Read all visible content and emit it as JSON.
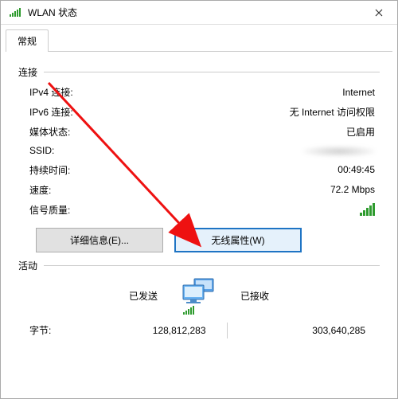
{
  "window": {
    "title": "WLAN 状态"
  },
  "tabs": {
    "general": "常规"
  },
  "conn": {
    "section": "连接",
    "ipv4_label": "IPv4 连接:",
    "ipv4_value": "Internet",
    "ipv6_label": "IPv6 连接:",
    "ipv6_value": "无 Internet 访问权限",
    "media_label": "媒体状态:",
    "media_value": "已启用",
    "ssid_label": "SSID:",
    "ssid_value": "",
    "duration_label": "持续时间:",
    "duration_value": "00:49:45",
    "speed_label": "速度:",
    "speed_value": "72.2 Mbps",
    "signal_label": "信号质量:"
  },
  "buttons": {
    "details": "详细信息(E)...",
    "wireless_props": "无线属性(W)"
  },
  "activity": {
    "section": "活动",
    "sent_label": "已发送",
    "recv_label": "已接收",
    "bytes_label": "字节:",
    "bytes_sent": "128,812,283",
    "bytes_recv": "303,640,285"
  }
}
